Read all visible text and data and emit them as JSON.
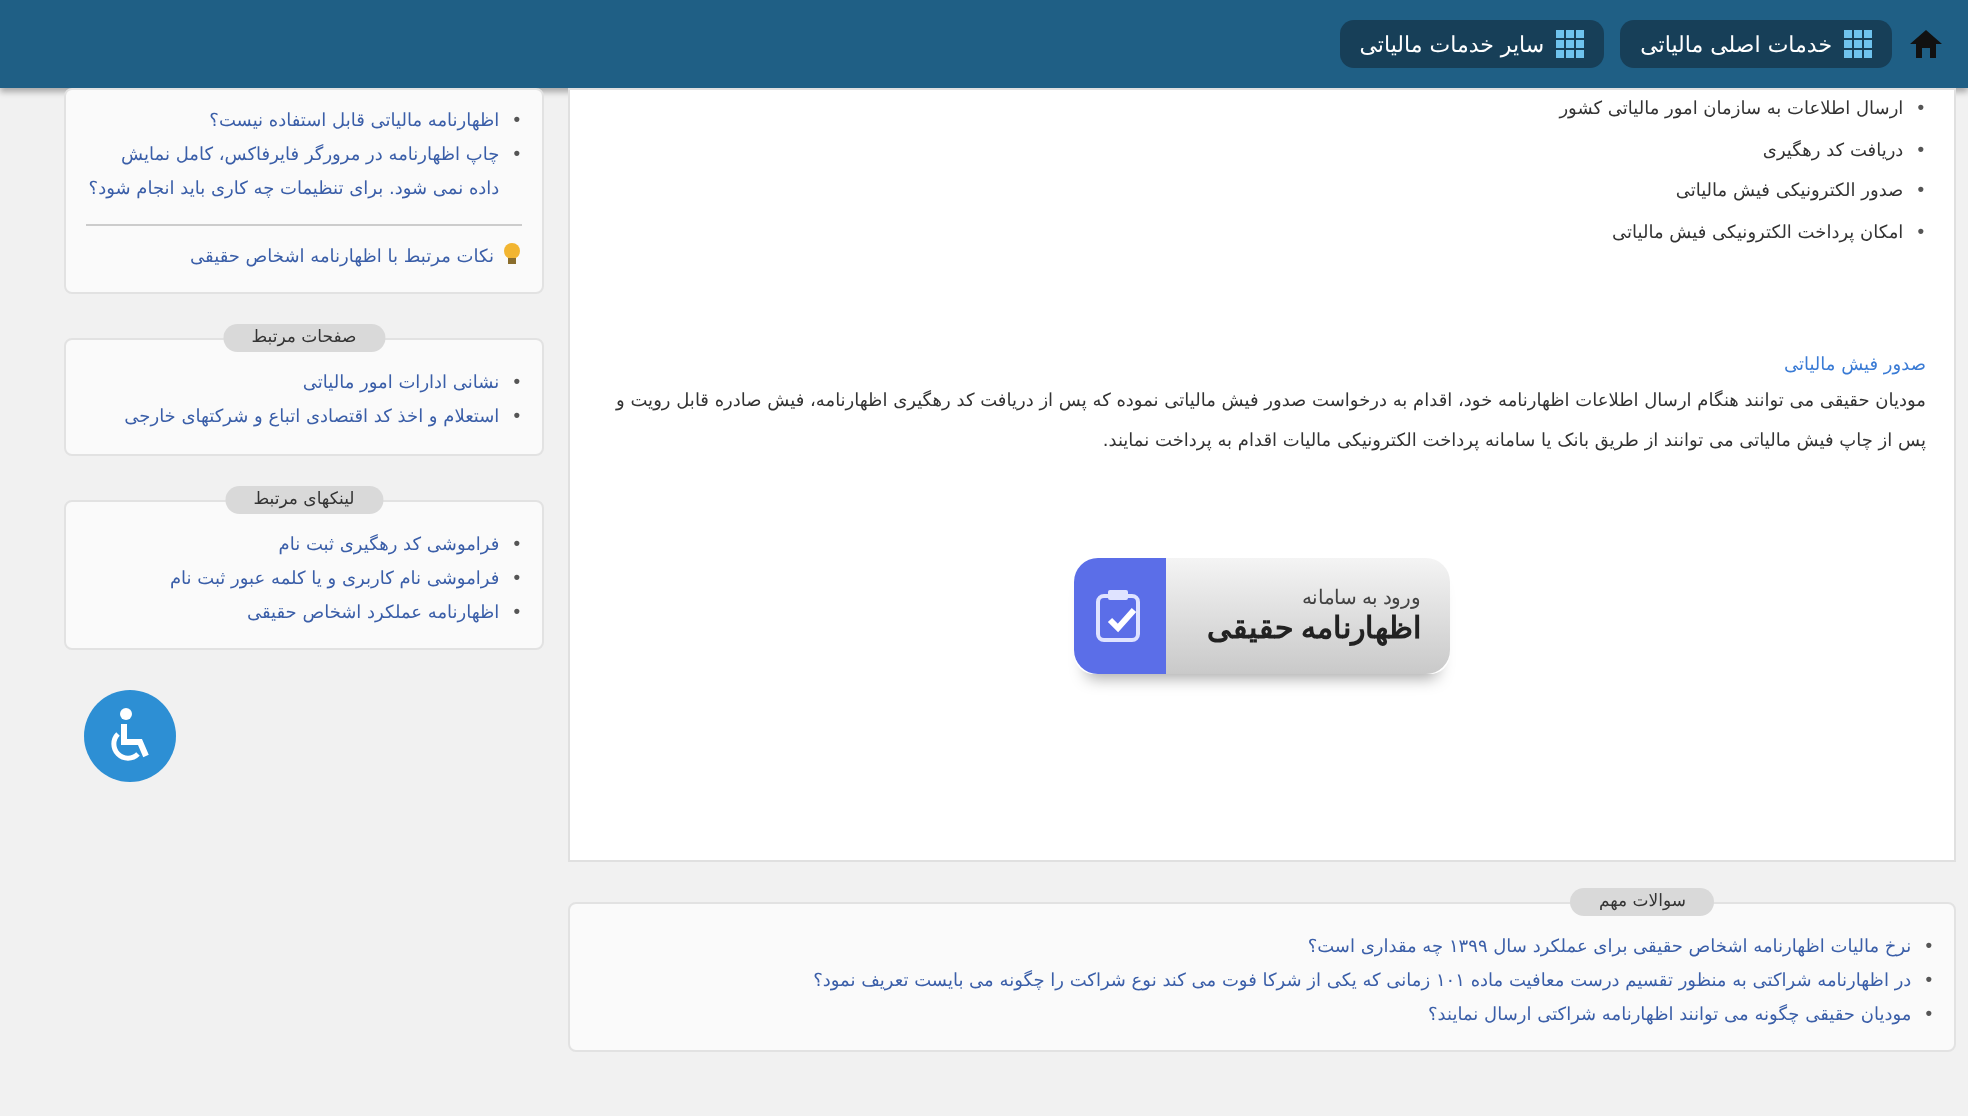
{
  "nav": {
    "items": [
      {
        "label": "خدمات اصلی مالیاتی"
      },
      {
        "label": "سایر خدمات مالیاتی"
      }
    ]
  },
  "sidebar": {
    "top_card": {
      "marker": "•",
      "items": [
        "اظهارنامه مالیاتی قابل استفاده نیست؟",
        "چاپ اظهارنامه در مرورگر فایرفاکس، کامل نمایش داده نمی شود. برای تنظیمات چه کاری باید انجام شود؟"
      ],
      "tip": "نکات مرتبط با اظهارنامه اشخاص حقیقی"
    },
    "cards": [
      {
        "title": "صفحات مرتبط",
        "marker": "•",
        "links": [
          "نشانی ادارات امور مالیاتی",
          "استعلام و اخذ کد اقتصادی اتباع و شرکتهای خارجی"
        ]
      },
      {
        "title": "لینکهای مرتبط",
        "marker": "•",
        "links": [
          "فراموشی کد رهگیری ثبت نام",
          "فراموشی نام کاربری و یا کلمه عبور ثبت نام",
          "اظهارنامه عملکرد اشخاص حقیقی"
        ]
      }
    ]
  },
  "main": {
    "marker": "•",
    "bullets": [
      "ارسال اطلاعات به سازمان امور مالیاتی کشور",
      "دریافت کد رهگیری",
      "صدور الکترونیکی فیش مالیاتی",
      "امکان پرداخت الکترونیکی فیش مالیاتی"
    ],
    "section_link": "صدور فیش مالیاتی",
    "paragraph": "مودیان حقیقی می توانند هنگام ارسال اطلاعات اظهارنامه خود، اقدام به درخواست صدور فیش مالیاتی نموده که پس از دریافت کد رهگیری اظهارنامه، فیش صادره قابل رویت و پس از چاپ فیش مالیاتی می توانند از طریق بانک یا سامانه پرداخت الکترونیکی مالیات اقدام به پرداخت نمایند.",
    "banner": {
      "line1": "ورود به سامانه",
      "line2": "اظهارنامه حقیقی"
    }
  },
  "faq": {
    "title": "سوالات مهم",
    "marker": "•",
    "items": [
      "نرخ مالیات اظهارنامه اشخاص حقیقی برای عملکرد سال ۱۳۹۹ چه مقداری است؟",
      "در اظهارنامه شراکتی به منظور تقسیم درست معافیت ماده ۱۰۱ زمانی که یکی از شرکا فوت می کند نوع شراکت را چگونه می بایست تعریف نمود؟",
      "مودیان حقیقی چگونه می توانند اظهارنامه شراکتی ارسال نمایند؟"
    ]
  }
}
